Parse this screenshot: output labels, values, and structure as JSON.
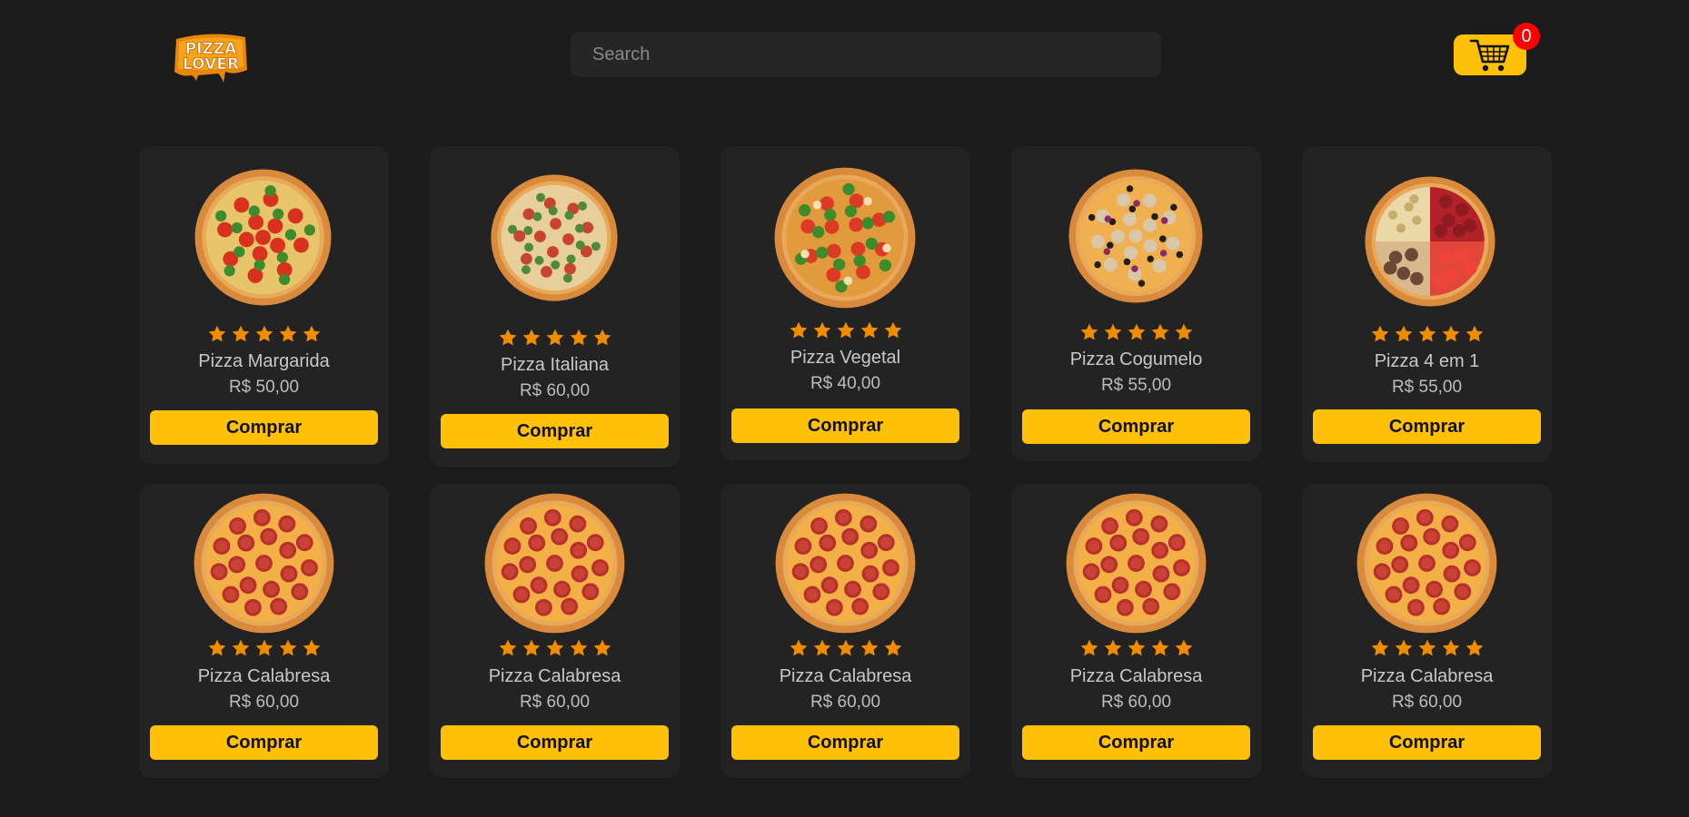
{
  "header": {
    "logo_text_line1": "PIZZA",
    "logo_text_line2": "LOVER",
    "search_placeholder": "Search",
    "cart_count": "0"
  },
  "colors": {
    "background": "#1c1c1c",
    "card": "#232323",
    "accent": "#ffc107",
    "star": "#f08c00",
    "badge": "#ff0000"
  },
  "products": [
    {
      "name": "Pizza Margarida",
      "price": "R$ 50,00",
      "button": "Comprar",
      "rating": 5,
      "image": "margherita-pizza"
    },
    {
      "name": "Pizza Italiana",
      "price": "R$ 60,00",
      "button": "Comprar",
      "rating": 5,
      "image": "italian-pizza"
    },
    {
      "name": "Pizza Vegetal",
      "price": "R$ 40,00",
      "button": "Comprar",
      "rating": 5,
      "image": "vegetable-pizza"
    },
    {
      "name": "Pizza Cogumelo",
      "price": "R$ 55,00",
      "button": "Comprar",
      "rating": 5,
      "image": "mushroom-pizza"
    },
    {
      "name": "Pizza 4 em 1",
      "price": "R$ 55,00",
      "button": "Comprar",
      "rating": 5,
      "image": "four-in-one-pizza"
    },
    {
      "name": "Pizza Calabresa",
      "price": "R$ 60,00",
      "button": "Comprar",
      "rating": 5,
      "image": "pepperoni-pizza"
    },
    {
      "name": "Pizza Calabresa",
      "price": "R$ 60,00",
      "button": "Comprar",
      "rating": 5,
      "image": "pepperoni-pizza"
    },
    {
      "name": "Pizza Calabresa",
      "price": "R$ 60,00",
      "button": "Comprar",
      "rating": 5,
      "image": "pepperoni-pizza"
    },
    {
      "name": "Pizza Calabresa",
      "price": "R$ 60,00",
      "button": "Comprar",
      "rating": 5,
      "image": "pepperoni-pizza"
    },
    {
      "name": "Pizza Calabresa",
      "price": "R$ 60,00",
      "button": "Comprar",
      "rating": 5,
      "image": "pepperoni-pizza"
    }
  ]
}
